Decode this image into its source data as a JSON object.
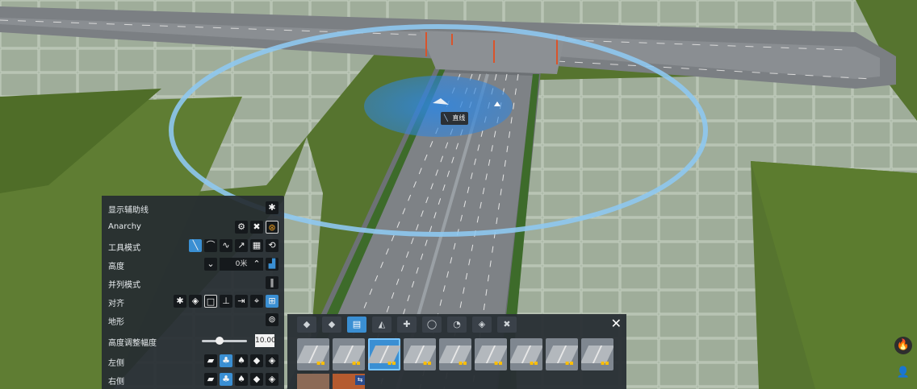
{
  "tooltip": {
    "icon": "straight-road-icon",
    "text": "直线"
  },
  "panel": {
    "rows": [
      {
        "label": "显示辅助线"
      },
      {
        "label": "Anarchy"
      },
      {
        "label": "工具模式"
      },
      {
        "label": "高度",
        "value": "0米"
      },
      {
        "label": "并列模式"
      },
      {
        "label": "对齐"
      },
      {
        "label": "地形"
      },
      {
        "label": "高度调整幅度",
        "value": "10.00",
        "slider_fraction": 0.4
      },
      {
        "label": "左侧"
      },
      {
        "label": "右侧"
      }
    ]
  },
  "picker": {
    "tabs": [
      "roads",
      "road-alt",
      "road-straight",
      "quay",
      "intersection",
      "roundabout",
      "pathway",
      "area",
      "utilities"
    ],
    "selected_tab": 2,
    "tile_count": 9,
    "selected_tile": 2,
    "close_label": "✕"
  },
  "colors": {
    "accent": "#3a8fd3",
    "panel_bg": "#262c32",
    "grass": "#5f7a3a",
    "tile_grid": "#a8b5a3"
  }
}
